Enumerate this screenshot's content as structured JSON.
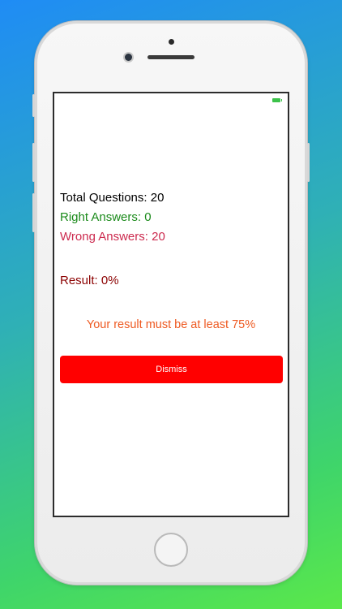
{
  "app": {
    "total_questions_label": "Total Questions: 20",
    "right_answers_label": "Right Answers: 0",
    "wrong_answers_label": "Wrong Answers: 20",
    "result_label": "Result: 0%",
    "requirement_message": "Your result must be at least 75%",
    "dismiss_label": "Dismiss"
  },
  "status_bar": {
    "battery_icon": "battery-charging-icon"
  },
  "colors": {
    "background_gradient_start": "#1f8cf5",
    "background_gradient_end": "#5be84a",
    "right_answers": "#1a8a1a",
    "wrong_answers": "#cc2a4e",
    "result": "#8b0000",
    "requirement": "#ee5a22",
    "dismiss_button": "#ff0000"
  }
}
